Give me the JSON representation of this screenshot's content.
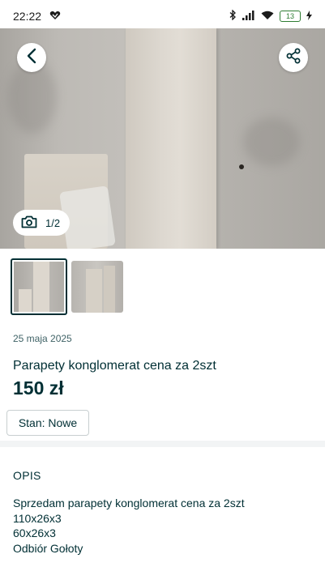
{
  "status_bar": {
    "time": "22:22",
    "battery": "13",
    "icons": [
      "notification-icon",
      "bluetooth-icon",
      "signal-icon",
      "wifi-icon",
      "battery-icon",
      "charging-icon"
    ]
  },
  "gallery": {
    "counter": "1/2",
    "back_icon": "chevron-left-icon",
    "share_icon": "share-icon",
    "camera_icon": "camera-icon",
    "thumbnails": [
      "photo-1",
      "photo-2"
    ]
  },
  "listing": {
    "date": "25 maja 2025",
    "title": "Parapety konglomerat cena za 2szt",
    "price": "150 zł",
    "condition": "Stan: Nowe"
  },
  "description": {
    "heading": "OPIS",
    "lines": [
      "Sprzedam parapety konglomerat cena za 2szt",
      "110x26x3",
      "60x26x3",
      "Odbiór Gołoty"
    ]
  },
  "colors": {
    "text_primary": "#002f34",
    "text_secondary": "#406367",
    "divider": "#f2f4f5"
  }
}
